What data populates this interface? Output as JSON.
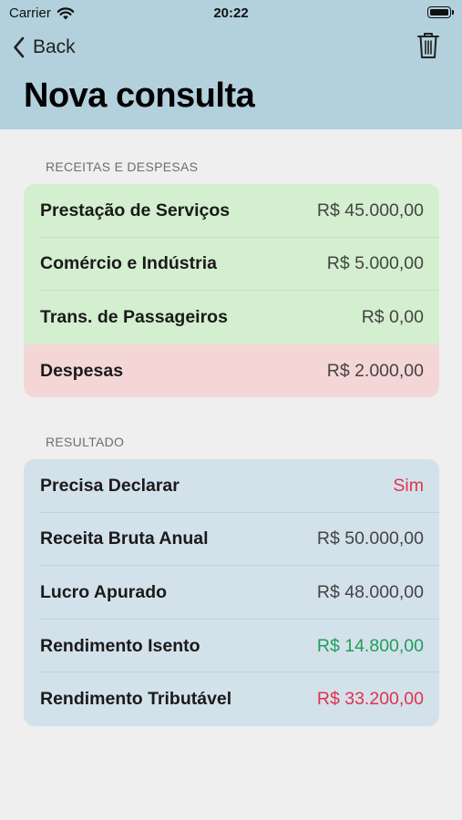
{
  "status_bar": {
    "carrier": "Carrier",
    "time": "20:22"
  },
  "nav": {
    "back_label": "Back",
    "title": "Nova consulta"
  },
  "sections": {
    "receitas": {
      "header": "RECEITAS E DESPESAS",
      "rows": [
        {
          "label": "Prestação de Serviços",
          "value": "R$ 45.000,00"
        },
        {
          "label": "Comércio e Indústria",
          "value": "R$ 5.000,00"
        },
        {
          "label": "Trans. de Passageiros",
          "value": "R$ 0,00"
        },
        {
          "label": "Despesas",
          "value": "R$ 2.000,00"
        }
      ]
    },
    "resultado": {
      "header": "RESULTADO",
      "rows": [
        {
          "label": "Precisa Declarar",
          "value": "Sim"
        },
        {
          "label": "Receita Bruta Anual",
          "value": "R$ 50.000,00"
        },
        {
          "label": "Lucro Apurado",
          "value": "R$ 48.000,00"
        },
        {
          "label": "Rendimento Isento",
          "value": "R$ 14.800,00"
        },
        {
          "label": "Rendimento Tributável",
          "value": "R$ 33.200,00"
        }
      ]
    }
  },
  "colors": {
    "header_bg": "#b3d0dd",
    "income_bg": "#d4efcf",
    "expense_bg": "#f5d6d6",
    "result_bg": "#d3e1eb",
    "negative": "#e0334a",
    "positive": "#1f9e5a"
  },
  "icons": {
    "back": "chevron-left-icon",
    "delete": "trash-icon",
    "wifi": "wifi-icon",
    "battery": "battery-icon"
  }
}
